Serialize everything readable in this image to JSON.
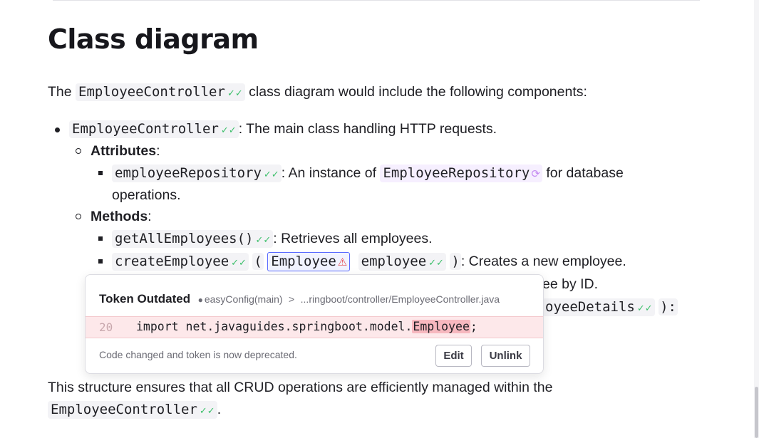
{
  "heading": "Class diagram",
  "intro": {
    "prefix": "The",
    "token": "EmployeeController",
    "suffix": "class diagram would include the following components:"
  },
  "items": {
    "controller": {
      "token": "EmployeeController",
      "text": ": The main class handling HTTP requests."
    },
    "attributes_label": "Attributes",
    "repo": {
      "token": "employeeRepository",
      "text_a": ": An instance of",
      "token2": "EmployeeRepository",
      "text_b": "for database",
      "text_c": "operations."
    },
    "methods_label": "Methods",
    "getall": {
      "token": "getAllEmployees()",
      "text": ": Retrieves all employees."
    },
    "create": {
      "token": "createEmployee",
      "open": "(",
      "token_err": "Employee",
      "token3": "employee",
      "close": ")",
      "text": ": Creates a new employee."
    },
    "partial1": "ee by ID.",
    "partial2_token": "oyeeDetails",
    "partial2_close": "):"
  },
  "conclusion": {
    "line1": "This structure ensures that all CRUD operations are efficiently managed within the",
    "token": "EmployeeController",
    "end": "."
  },
  "popup": {
    "title": "Token Outdated",
    "repo": "easyConfig(main)",
    "sep": ">",
    "path": "...ringboot/controller/EmployeeController.java",
    "line_number": "20",
    "code_before": "import net.javaguides.springboot.model.",
    "code_highlight": "Employee",
    "code_after": ";",
    "message": "Code changed and token is now deprecated.",
    "edit_label": "Edit",
    "unlink_label": "Unlink"
  },
  "colors": {
    "ok": "#3ec06c",
    "warning": "#e5484d",
    "sync": "#c58bf2",
    "error_border": "#5b6cff"
  },
  "icons": {
    "ok": "check-icon",
    "sync": "sync-icon",
    "warning": "warning-icon",
    "repo": "github-icon"
  }
}
